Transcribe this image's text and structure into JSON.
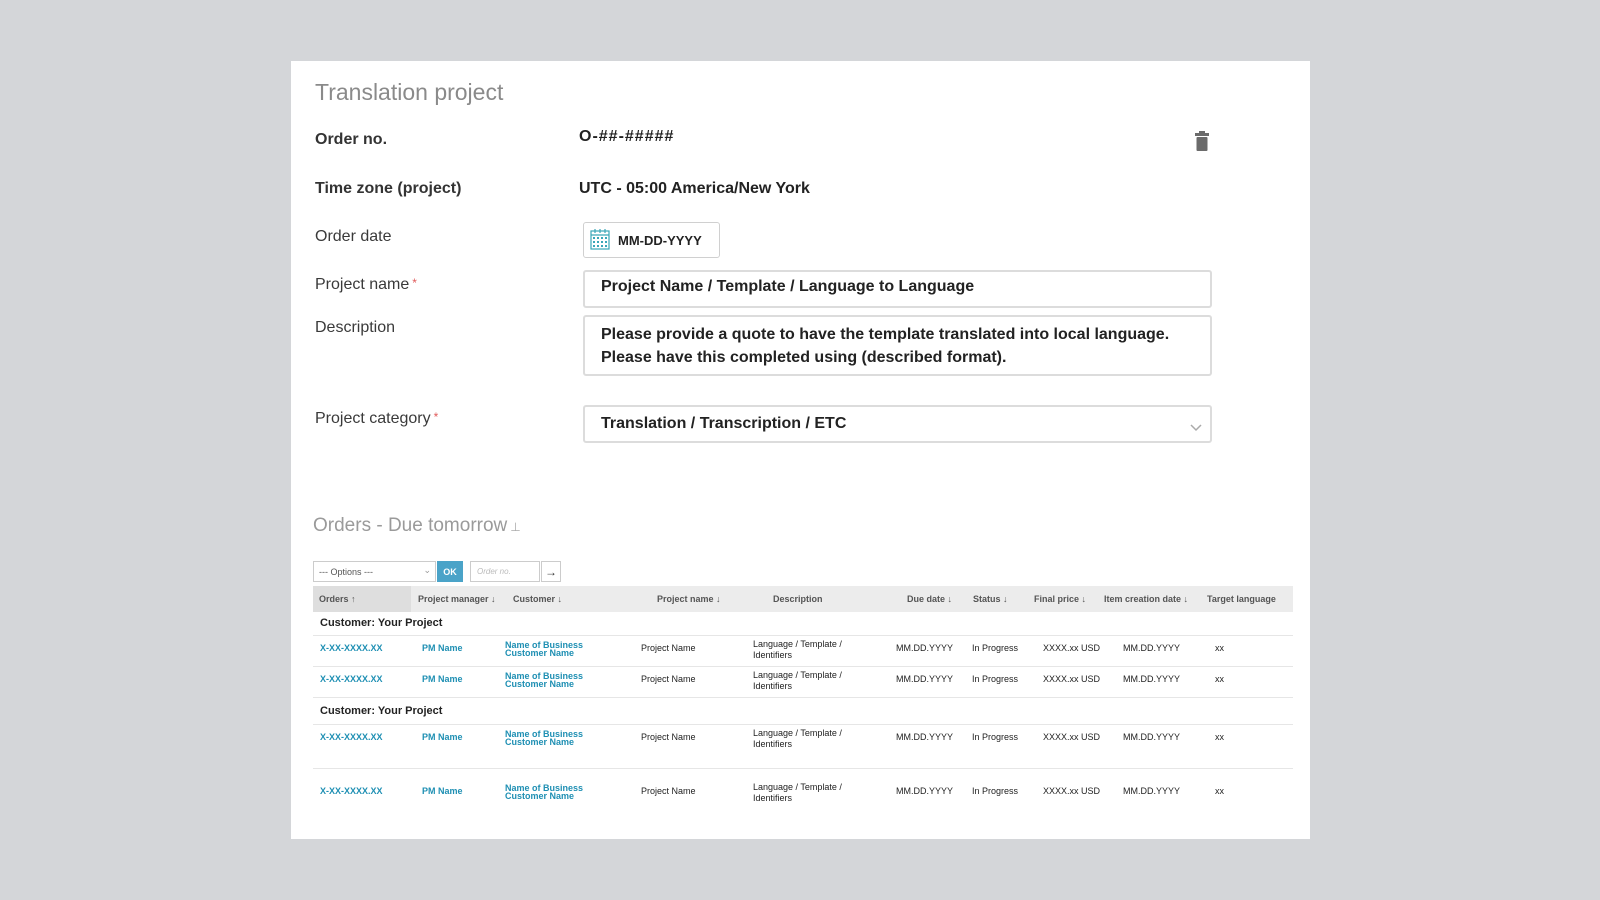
{
  "form": {
    "title": "Translation project",
    "order_no_label": "Order no.",
    "order_no_value": "O-##-#####",
    "timezone_label": "Time zone (project)",
    "timezone_value": "UTC - 05:00 America/New York",
    "order_date_label": "Order date",
    "order_date_value": "MM-DD-YYYY",
    "project_name_label": "Project name",
    "required_mark": "*",
    "project_name_value": "Project Name / Template / Language to Language",
    "description_label": "Description",
    "description_value": "Please provide a quote to have the template translated into local language. Please have this completed using (described format).",
    "category_label": "Project category",
    "category_value": "Translation / Transcription / ETC"
  },
  "orders": {
    "section_title": "Orders - Due tomorrow",
    "options_placeholder": "--- Options ---",
    "ok_label": "OK",
    "order_no_placeholder": "Order no.",
    "columns": [
      "Orders ↑",
      "Project manager ↓",
      "Customer ↓",
      "Project name ↓",
      "Description",
      "Due date ↓",
      "Status ↓",
      "Final price ↓",
      "Item creation date ↓",
      "Target language"
    ],
    "groups": [
      {
        "label": "Customer: Your Project",
        "rows": [
          {
            "order": "X-XX-XXXX.XX",
            "pm": "PM Name",
            "customer1": "Name of Business",
            "customer2": "Customer Name",
            "project": "Project Name",
            "desc1": "Language / Template /",
            "desc2": "Identifiers",
            "due": "MM.DD.YYYY",
            "status": "In Progress",
            "price": "XXXX.xx USD",
            "created": "MM.DD.YYYY",
            "target": "xx"
          },
          {
            "order": "X-XX-XXXX.XX",
            "pm": "PM Name",
            "customer1": "Name of Business",
            "customer2": "Customer Name",
            "project": "Project Name",
            "desc1": "Language / Template /",
            "desc2": "Identifiers",
            "due": "MM.DD.YYYY",
            "status": "In Progress",
            "price": "XXXX.xx USD",
            "created": "MM.DD.YYYY",
            "target": "xx"
          }
        ]
      },
      {
        "label": "Customer: Your Project",
        "rows": [
          {
            "order": "X-XX-XXXX.XX",
            "pm": "PM Name",
            "customer1": "Name of Business",
            "customer2": "Customer Name",
            "project": "Project Name",
            "desc1": "Language / Template /",
            "desc2": "Identifiers",
            "due": "MM.DD.YYYY",
            "status": "In Progress",
            "price": "XXXX.xx USD",
            "created": "MM.DD.YYYY",
            "target": "xx"
          },
          {
            "order": "X-XX-XXXX.XX",
            "pm": "PM Name",
            "customer1": "Name of Business",
            "customer2": "Customer Name",
            "project": "Project Name",
            "desc1": "Language / Template /",
            "desc2": "Identifiers",
            "due": "MM.DD.YYYY",
            "status": "In Progress",
            "price": "XXXX.xx USD",
            "created": "MM.DD.YYYY",
            "target": "xx"
          }
        ]
      }
    ]
  },
  "icons": {
    "trash": "trash-icon",
    "calendar": "calendar-icon",
    "chevron": "chevron-down-icon",
    "pin": "pin-icon",
    "arrow": "arrow-right-icon"
  },
  "colors": {
    "accent": "#1e8fb3",
    "ok_button": "#4aa3c8",
    "required": "#e05a5a"
  }
}
